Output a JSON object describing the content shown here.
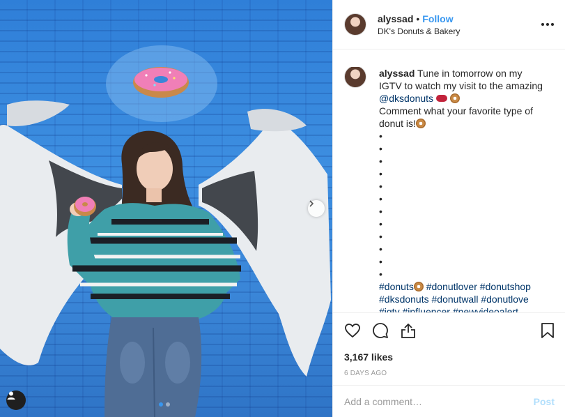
{
  "post": {
    "image_alt": "",
    "carousel_count": 2,
    "carousel_index": 1
  },
  "header": {
    "username": "alyssad",
    "separator": "•",
    "follow_label": "Follow",
    "location": "DK's Donuts & Bakery"
  },
  "caption": {
    "username": "alyssad",
    "line1": "Tune in tomorrow on my IGTV to watch my visit to the amazing",
    "mention": "@dksdonuts",
    "line2": "Comment what your favorite type of donut is!",
    "bullets": [
      "•",
      "•",
      "•",
      "•",
      "•",
      "•",
      "•",
      "•",
      "•",
      "•",
      "•",
      "•"
    ],
    "hashtags": [
      "#donuts",
      "#donutlover",
      "#donutshop",
      "#dksdonuts",
      "#donutwall",
      "#donutlove",
      "#igtv",
      "#influencer",
      "#newvideoalert"
    ]
  },
  "actions": {
    "likes": "3,167 likes",
    "timestamp": "6 DAYS AGO"
  },
  "comment_box": {
    "placeholder": "Add a comment…",
    "post_label": "Post"
  },
  "colors": {
    "accent": "#3897f0",
    "link": "#003569",
    "post_disabled": "#b2dffc",
    "wall_blue": "#3a86d8"
  },
  "icons": [
    "heart-icon",
    "comment-icon",
    "share-icon",
    "bookmark-icon",
    "more-options-icon",
    "chevron-right-icon",
    "user-tag-icon",
    "donut-emoji-icon",
    "speech-bubble-emoji-icon"
  ]
}
